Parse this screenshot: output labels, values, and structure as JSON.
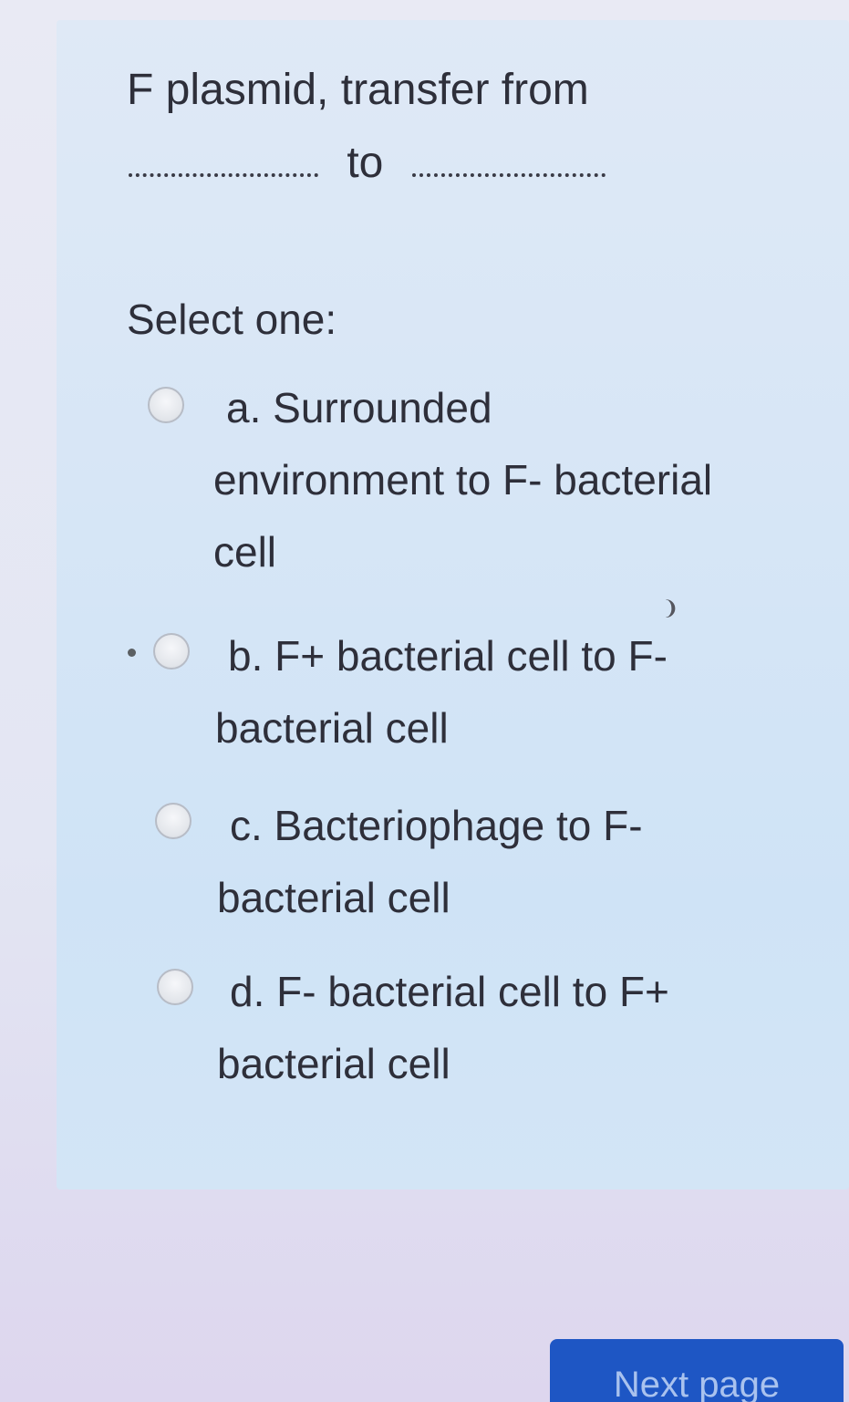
{
  "question": {
    "text_line1": "F plasmid, transfer from",
    "text_middle": "to"
  },
  "prompt": "Select one:",
  "options": [
    {
      "label": "a. Surrounded\nenvironment to F- bacterial\ncell",
      "selected": false
    },
    {
      "label": "b. F+ bacterial cell to F-\nbacterial cell",
      "selected": false
    },
    {
      "label": "c. Bacteriophage to F-\nbacterial cell",
      "selected": false
    },
    {
      "label": "d. F- bacterial cell to F+\nbacterial cell",
      "selected": false
    }
  ],
  "navigation": {
    "next_label": "Next page"
  },
  "colors": {
    "text": "#2e2f3a",
    "card": "#d7e6f6",
    "button": "#1e56c4"
  }
}
